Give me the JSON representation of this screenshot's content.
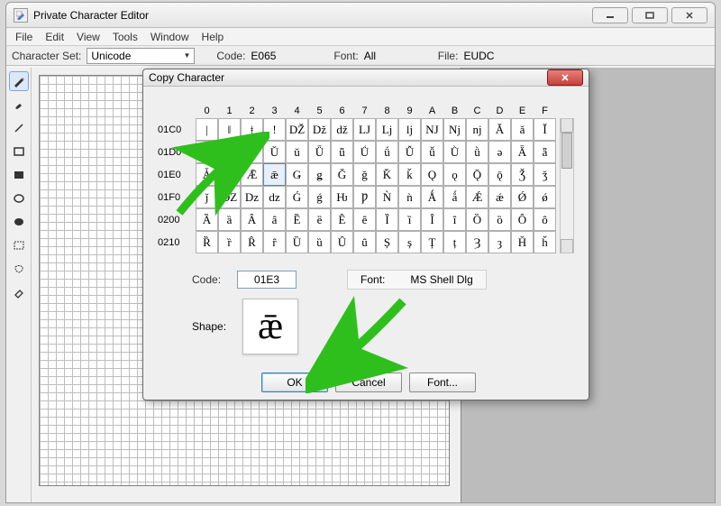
{
  "window": {
    "title": "Private Character Editor",
    "menus": [
      "File",
      "Edit",
      "View",
      "Tools",
      "Window",
      "Help"
    ]
  },
  "infobar": {
    "charset_label": "Character Set:",
    "charset_value": "Unicode",
    "code_label": "Code:",
    "code_value": "E065",
    "font_label": "Font:",
    "font_value": "All",
    "file_label": "File:",
    "file_value": "EUDC"
  },
  "dialog": {
    "title": "Copy Character",
    "cols": [
      "0",
      "1",
      "2",
      "3",
      "4",
      "5",
      "6",
      "7",
      "8",
      "9",
      "A",
      "B",
      "C",
      "D",
      "E",
      "F"
    ],
    "rows": [
      {
        "hdr": "01C0",
        "cells": [
          "|",
          "‖",
          "ǂ",
          "!",
          "Ǆ",
          "ǅ",
          "ǆ",
          "Ǉ",
          "ǈ",
          "ǉ",
          "Ǌ",
          "ǋ",
          "ǌ",
          "Ǎ",
          "ǎ",
          "Ǐ"
        ]
      },
      {
        "hdr": "01D0",
        "cells": [
          "ǐ",
          "Ǒ",
          "ǒ",
          "Ǔ",
          "ǔ",
          "Ǖ",
          "ǖ",
          "Ǘ",
          "ǘ",
          "Ǚ",
          "ǚ",
          "Ǜ",
          "ǜ",
          "ǝ",
          "Ǟ",
          "ǟ"
        ]
      },
      {
        "hdr": "01E0",
        "cells": [
          "Ǡ",
          "ǡ",
          "Ǣ",
          "ǣ",
          "Ǥ",
          "ǥ",
          "Ǧ",
          "ǧ",
          "Ǩ",
          "ǩ",
          "Ǫ",
          "ǫ",
          "Ǭ",
          "ǭ",
          "Ǯ",
          "ǯ"
        ]
      },
      {
        "hdr": "01F0",
        "cells": [
          "ǰ",
          "Ǳ",
          "ǲ",
          "ǳ",
          "Ǵ",
          "ǵ",
          "Ƕ",
          "Ƿ",
          "Ǹ",
          "ǹ",
          "Ǻ",
          "ǻ",
          "Ǽ",
          "ǽ",
          "Ǿ",
          "ǿ"
        ]
      },
      {
        "hdr": "0200",
        "cells": [
          "Ȁ",
          "ȁ",
          "Ȃ",
          "ȃ",
          "Ȅ",
          "ȅ",
          "Ȇ",
          "ȇ",
          "Ȉ",
          "ȉ",
          "Ȋ",
          "ȋ",
          "Ȍ",
          "ȍ",
          "Ȏ",
          "ȏ"
        ]
      },
      {
        "hdr": "0210",
        "cells": [
          "Ȑ",
          "ȑ",
          "Ȓ",
          "ȓ",
          "Ȕ",
          "ȕ",
          "Ȗ",
          "ȗ",
          "Ș",
          "ș",
          "Ț",
          "ț",
          "Ȝ",
          "ȝ",
          "Ȟ",
          "ȟ"
        ]
      }
    ],
    "selected_row": 2,
    "selected_col": 3,
    "code_label": "Code:",
    "code_value": "01E3",
    "font_label": "Font:",
    "font_value": "MS Shell Dlg",
    "shape_label": "Shape:",
    "shape_glyph": "ǣ",
    "buttons": {
      "ok": "OK",
      "cancel": "Cancel",
      "font": "Font..."
    }
  }
}
